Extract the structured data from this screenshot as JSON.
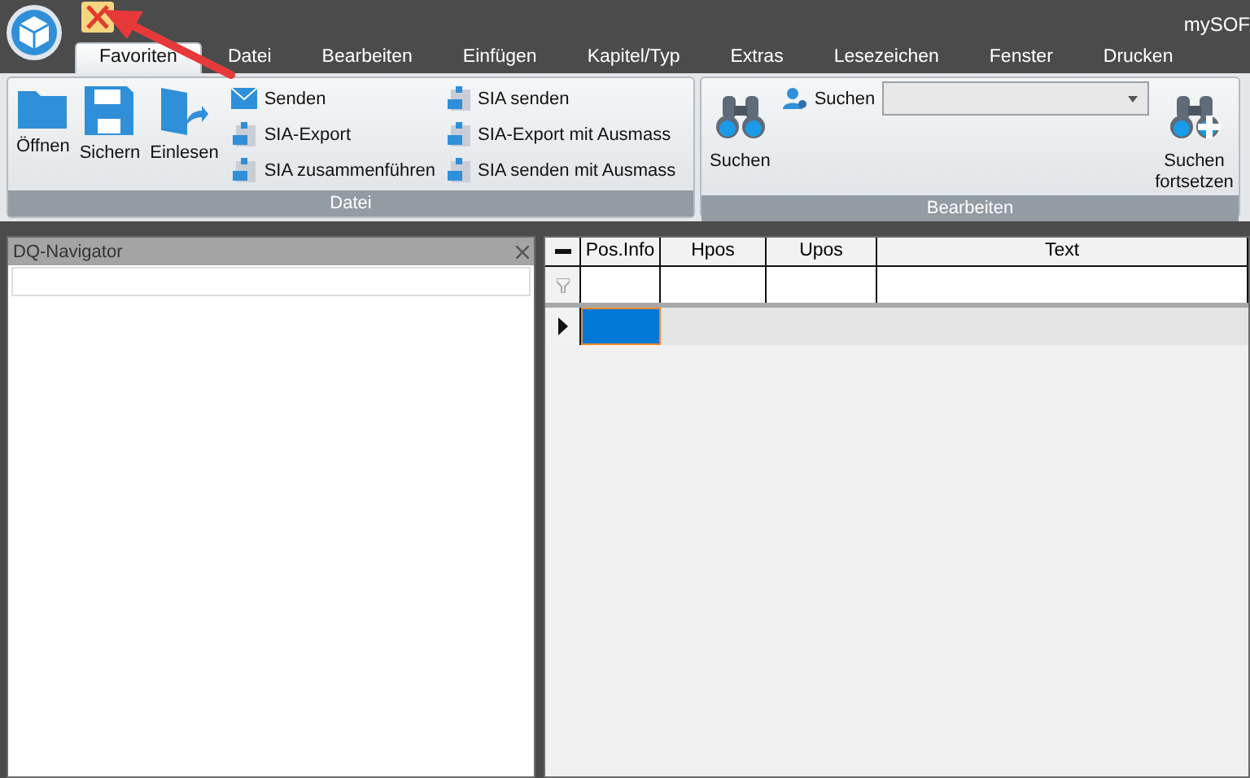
{
  "app": {
    "title": "mySOF"
  },
  "tabs": [
    {
      "label": "Favoriten",
      "selected": true
    },
    {
      "label": "Datei",
      "selected": false
    },
    {
      "label": "Bearbeiten",
      "selected": false
    },
    {
      "label": "Einfügen",
      "selected": false
    },
    {
      "label": "Kapitel/Typ",
      "selected": false
    },
    {
      "label": "Extras",
      "selected": false
    },
    {
      "label": "Lesezeichen",
      "selected": false
    },
    {
      "label": "Fenster",
      "selected": false
    },
    {
      "label": "Drucken",
      "selected": false
    }
  ],
  "ribbon": {
    "datei": {
      "label": "Datei",
      "large_buttons": [
        {
          "label": "Öffnen",
          "kind": "folder"
        },
        {
          "label": "Sichern",
          "kind": "disk"
        },
        {
          "label": "Einlesen",
          "kind": "import"
        }
      ],
      "small_buttons": [
        {
          "label": "Senden",
          "kind": "mail"
        },
        {
          "label": "SIA-Export",
          "kind": "sia"
        },
        {
          "label": "SIA zusammenführen",
          "kind": "sia"
        },
        {
          "label": "SIA senden",
          "kind": "sia"
        },
        {
          "label": "SIA-Export mit Ausmass",
          "kind": "sia"
        },
        {
          "label": "SIA senden mit Ausmass",
          "kind": "sia"
        }
      ]
    },
    "bearbeiten": {
      "label": "Bearbeiten",
      "search_button": "Suchen",
      "search_label": "Suchen",
      "continue_button": "Suchen fortsetzen"
    }
  },
  "navigator": {
    "title": "DQ-Navigator"
  },
  "grid": {
    "columns": [
      "Pos.Info",
      "Hpos",
      "Upos",
      "Text"
    ],
    "new_row": {
      "cells": [
        {
          "selected": true
        },
        {
          "selected": false
        },
        {
          "selected": false
        },
        {
          "selected": false
        }
      ]
    }
  }
}
